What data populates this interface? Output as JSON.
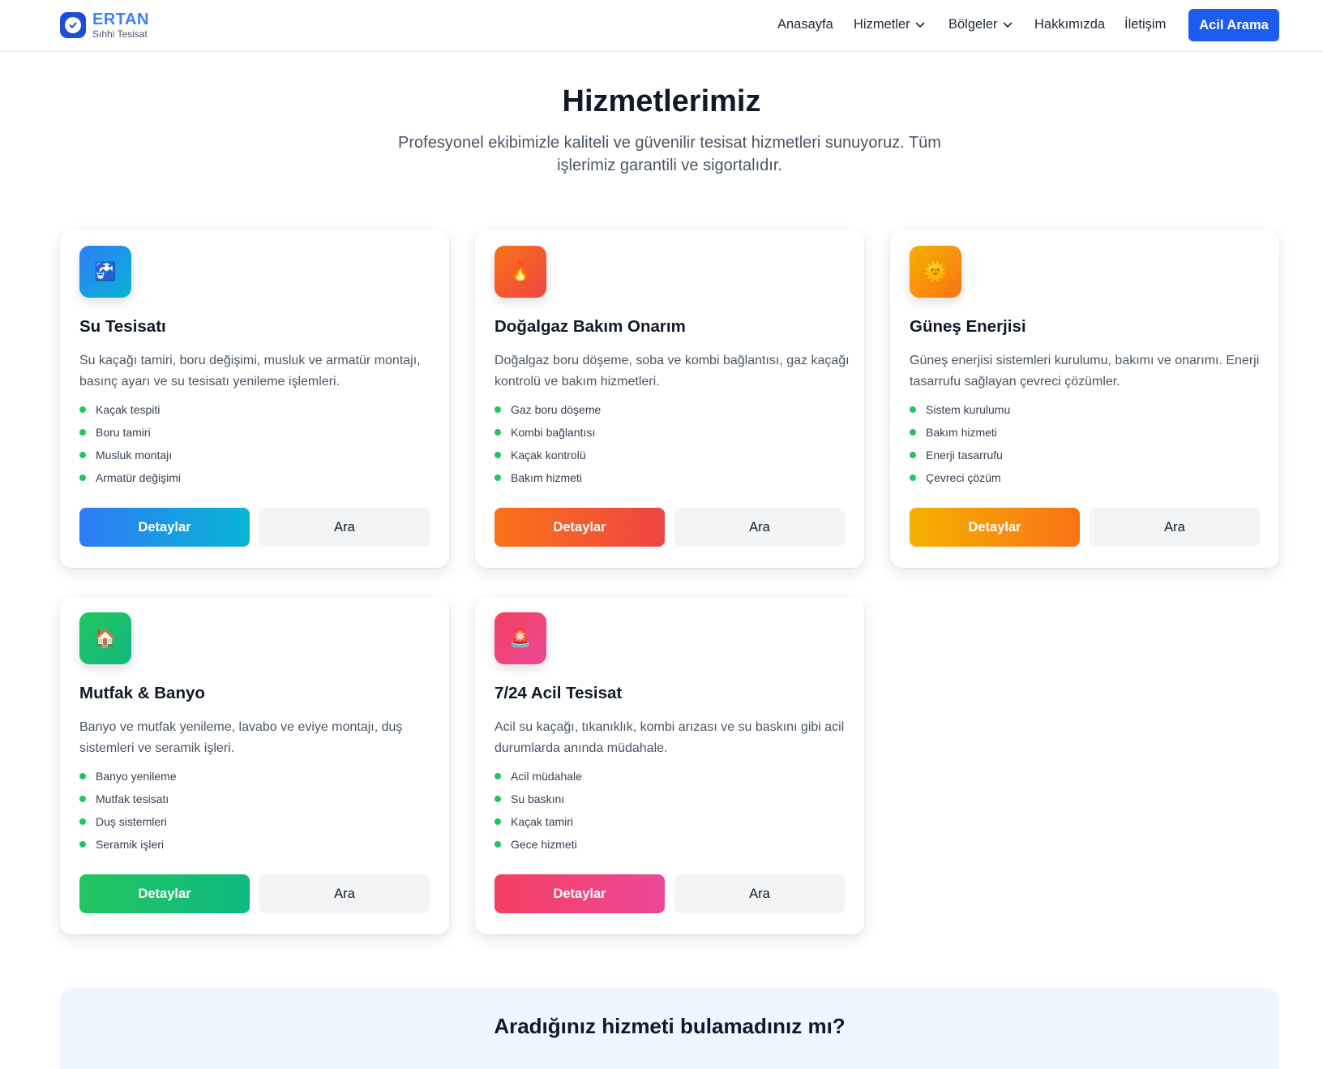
{
  "header": {
    "brand_name": "ERTAN",
    "brand_tagline": "Sıhhi Tesisat",
    "nav": [
      "Anasayfa",
      "Hizmetler",
      "Bölgeler",
      "Hakkımızda",
      "İletişim"
    ],
    "cta_label": "Acil Arama"
  },
  "hero": {
    "title": "Hizmetlerimiz",
    "subtitle": "Profesyonel ekibimizle kaliteli ve güvenilir tesisat hizmetleri sunuyoruz. Tüm işlerimiz garantili ve sigortalıdır."
  },
  "services": [
    {
      "icon": "faucet-icon",
      "icon_glyph": "🚰",
      "title": "Su Tesisatı",
      "description": "Su kaçağı tamiri, boru değişimi, musluk ve armatür montajı, basınç ayarı ve su tesisatı yenileme işlemleri.",
      "features": [
        "Kaçak tespiti",
        "Boru tamiri",
        "Musluk montajı",
        "Armatür değişimi"
      ],
      "primary_label": "Detaylar",
      "secondary_label": "Ara",
      "gradient": [
        "#2f7bf5",
        "#06b6d4"
      ]
    },
    {
      "icon": "fire-icon",
      "icon_glyph": "🔥",
      "title": "Doğalgaz Bakım Onarım",
      "description": "Doğalgaz boru döşeme, soba ve kombi bağlantısı, gaz kaçağı kontrolü ve bakım hizmetleri.",
      "features": [
        "Gaz boru döşeme",
        "Kombi bağlantısı",
        "Kaçak kontrolü",
        "Bakım hizmeti"
      ],
      "primary_label": "Detaylar",
      "secondary_label": "Ara",
      "gradient": [
        "#f97316",
        "#ef4444"
      ]
    },
    {
      "icon": "sun-icon",
      "icon_glyph": "🌞",
      "title": "Güneş Enerjisi",
      "description": "Güneş enerjisi sistemleri kurulumu, bakımı ve onarımı. Enerji tasarrufu sağlayan çevreci çözümler.",
      "features": [
        "Sistem kurulumu",
        "Bakım hizmeti",
        "Enerji tasarrufu",
        "Çevreci çözüm"
      ],
      "primary_label": "Detaylar",
      "secondary_label": "Ara",
      "gradient": [
        "#f5b100",
        "#f97316"
      ]
    },
    {
      "icon": "house-icon",
      "icon_glyph": "🏠",
      "title": "Mutfak & Banyo",
      "description": "Banyo ve mutfak yenileme, lavabo ve eviye montajı, duş sistemleri ve seramik işleri.",
      "features": [
        "Banyo yenileme",
        "Mutfak tesisatı",
        "Duş sistemleri",
        "Seramik işleri"
      ],
      "primary_label": "Detaylar",
      "secondary_label": "Ara",
      "gradient": [
        "#22c55e",
        "#10b981"
      ]
    },
    {
      "icon": "siren-icon",
      "icon_glyph": "🚨",
      "title": "7/24 Acil Tesisat",
      "description": "Acil su kaçağı, tıkanıklık, kombi arızası ve su baskını gibi acil durumlarda anında müdahale.",
      "features": [
        "Acil müdahale",
        "Su baskını",
        "Kaçak tamiri",
        "Gece hizmeti"
      ],
      "primary_label": "Detaylar",
      "secondary_label": "Ara",
      "gradient": [
        "#f43f5e",
        "#ec4899"
      ]
    }
  ],
  "bottom": {
    "title": "Aradığınız hizmeti bulamadınız mı?"
  }
}
